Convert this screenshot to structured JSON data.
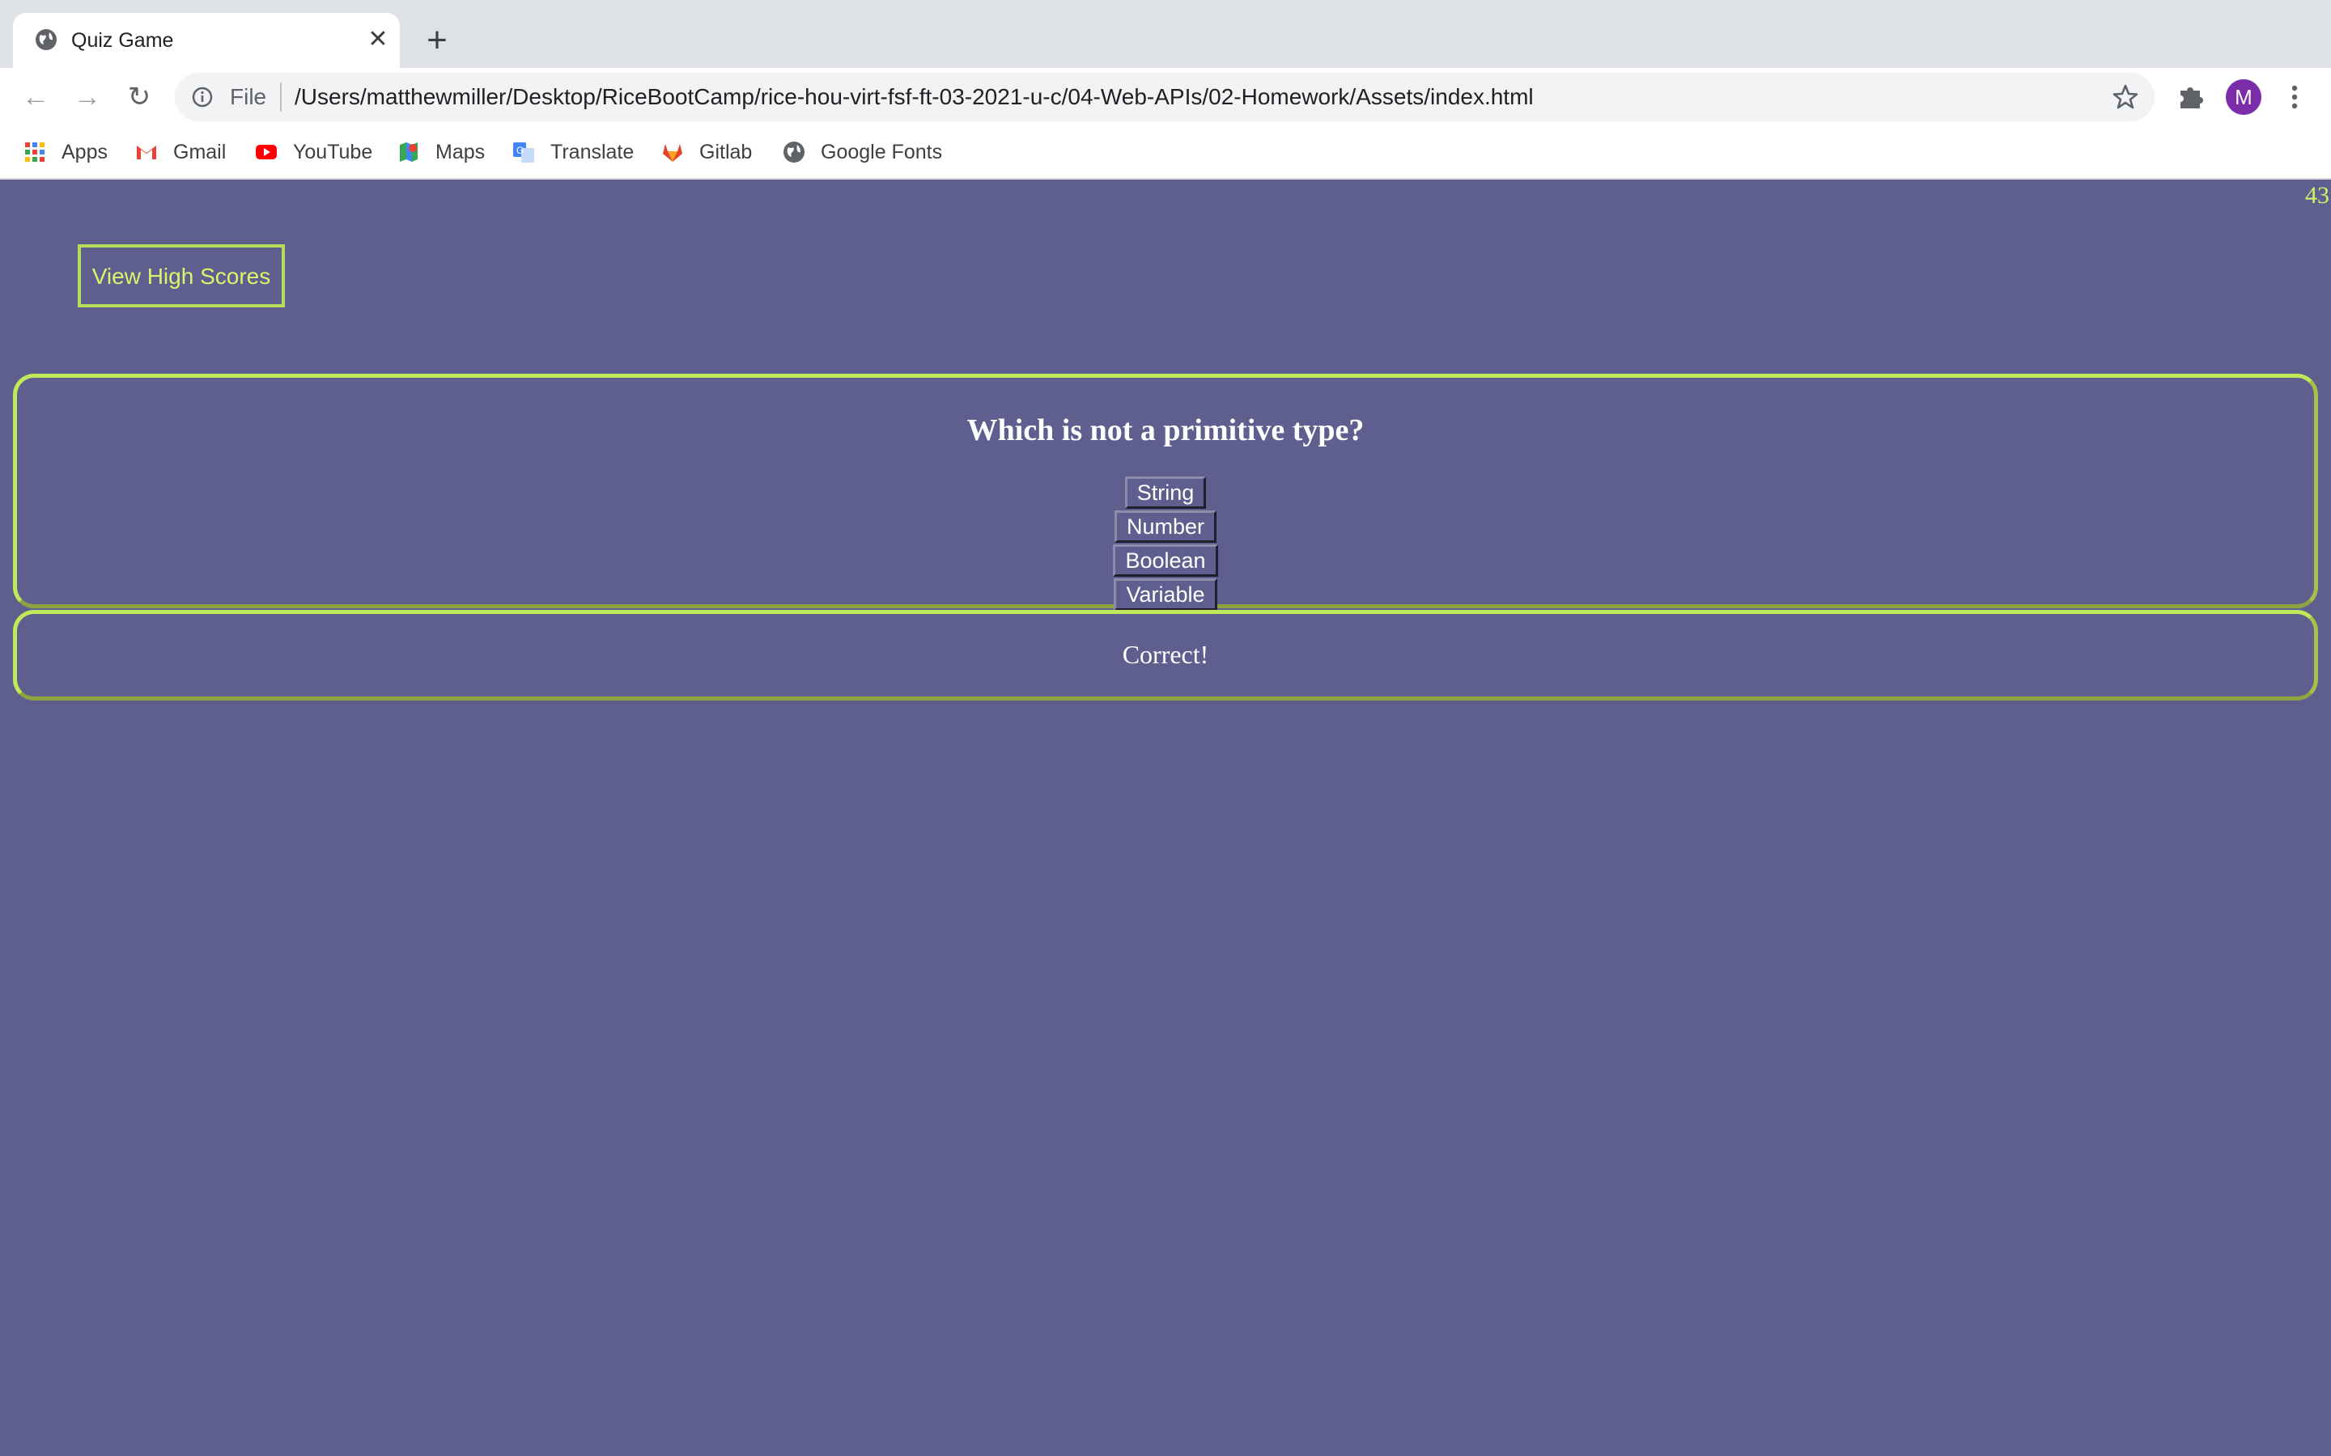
{
  "browser": {
    "tab": {
      "title": "Quiz Game",
      "close_glyph": "✕"
    },
    "new_tab_glyph": "+",
    "nav": {
      "back_glyph": "←",
      "forward_glyph": "→",
      "reload_glyph": "↻"
    },
    "address": {
      "scheme": "File",
      "url": "/Users/matthewmiller/Desktop/RiceBootCamp/rice-hou-virt-fsf-ft-03-2021-u-c/04-Web-APIs/02-Homework/Assets/index.html"
    },
    "profile_initial": "M",
    "bookmarks": [
      {
        "label": "Apps",
        "icon": "apps-grid-icon"
      },
      {
        "label": "Gmail",
        "icon": "gmail-icon"
      },
      {
        "label": "YouTube",
        "icon": "youtube-icon"
      },
      {
        "label": "Maps",
        "icon": "maps-icon"
      },
      {
        "label": "Translate",
        "icon": "translate-icon"
      },
      {
        "label": "Gitlab",
        "icon": "gitlab-icon"
      },
      {
        "label": "Google Fonts",
        "icon": "globe-icon"
      }
    ]
  },
  "page": {
    "timer": "43",
    "high_scores_label": "View High Scores",
    "question": "Which is not a primitive type?",
    "answers": [
      "String",
      "Number",
      "Boolean",
      "Variable"
    ],
    "feedback": "Correct!"
  },
  "colors": {
    "page_bg": "#5e5f8e",
    "accent": "#c1ea5a",
    "text": "#ffffff"
  }
}
